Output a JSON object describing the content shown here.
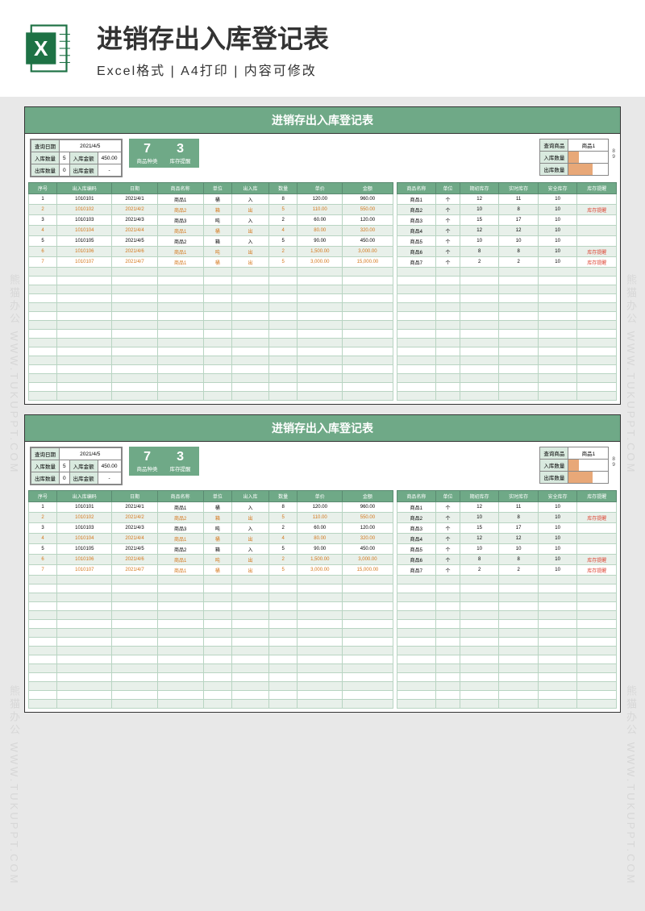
{
  "header": {
    "title": "进销存出入库登记表",
    "sub": "Excel格式 | A4打印 | 内容可修改"
  },
  "watermark": "熊猫办公 WWW.TUKUPPT.COM",
  "sheet": {
    "title": "进销存出入库登记表",
    "query": {
      "date_lbl": "查询日期",
      "date": "2021/4/5",
      "in_qty_lbl": "入库数量",
      "in_qty": "5",
      "in_amt_lbl": "入库金额",
      "in_amt": "450.00",
      "out_qty_lbl": "出库数量",
      "out_qty": "0",
      "out_amt_lbl": "出库金额",
      "out_amt": "-"
    },
    "summary": {
      "types": "7",
      "types_lbl": "商品种类",
      "alerts": "3",
      "alerts_lbl": "库存提醒"
    },
    "lookup": {
      "prod_lbl": "查询商品",
      "prod": "商品1",
      "in_lbl": "入库数量",
      "out_lbl": "出库数量",
      "in_bar": 25,
      "out_bar": 60,
      "n1": "8",
      "n2": "9"
    },
    "left_headers": [
      "序号",
      "出入库编码",
      "日期",
      "商品名称",
      "单位",
      "出入库",
      "数量",
      "单价",
      "金额"
    ],
    "left_rows": [
      {
        "c": [
          "1",
          "1010101",
          "2021/4/1",
          "商品1",
          "桶",
          "入",
          "8",
          "120.00",
          "960.00"
        ],
        "out": false
      },
      {
        "c": [
          "2",
          "1010102",
          "2021/4/2",
          "商品2",
          "箱",
          "出",
          "5",
          "110.00",
          "550.00"
        ],
        "out": true
      },
      {
        "c": [
          "3",
          "1010103",
          "2021/4/3",
          "商品3",
          "吨",
          "入",
          "2",
          "60.00",
          "120.00"
        ],
        "out": false
      },
      {
        "c": [
          "4",
          "1010104",
          "2021/4/4",
          "商品1",
          "桶",
          "出",
          "4",
          "80.00",
          "320.00"
        ],
        "out": true
      },
      {
        "c": [
          "5",
          "1010105",
          "2021/4/5",
          "商品2",
          "箱",
          "入",
          "5",
          "90.00",
          "450.00"
        ],
        "out": false
      },
      {
        "c": [
          "6",
          "1010106",
          "2021/4/6",
          "商品1",
          "吨",
          "出",
          "2",
          "1,500.00",
          "3,000.00"
        ],
        "out": true
      },
      {
        "c": [
          "7",
          "1010107",
          "2021/4/7",
          "商品1",
          "桶",
          "出",
          "5",
          "3,000.00",
          "15,000.00"
        ],
        "out": true
      }
    ],
    "right_headers": [
      "商品名称",
      "单位",
      "期初库存",
      "实时库存",
      "安全库存",
      "库存提醒"
    ],
    "right_rows": [
      {
        "c": [
          "商品1",
          "个",
          "12",
          "11",
          "10",
          ""
        ],
        "alert": false
      },
      {
        "c": [
          "商品2",
          "个",
          "10",
          "8",
          "10",
          "库存提醒"
        ],
        "alert": true
      },
      {
        "c": [
          "商品3",
          "个",
          "15",
          "17",
          "10",
          ""
        ],
        "alert": false
      },
      {
        "c": [
          "商品4",
          "个",
          "12",
          "12",
          "10",
          ""
        ],
        "alert": false
      },
      {
        "c": [
          "商品5",
          "个",
          "10",
          "10",
          "10",
          ""
        ],
        "alert": false
      },
      {
        "c": [
          "商品6",
          "个",
          "8",
          "8",
          "10",
          "库存提醒"
        ],
        "alert": true
      },
      {
        "c": [
          "商品7",
          "个",
          "2",
          "2",
          "10",
          "库存提醒"
        ],
        "alert": true
      }
    ],
    "empty_rows": 15
  }
}
